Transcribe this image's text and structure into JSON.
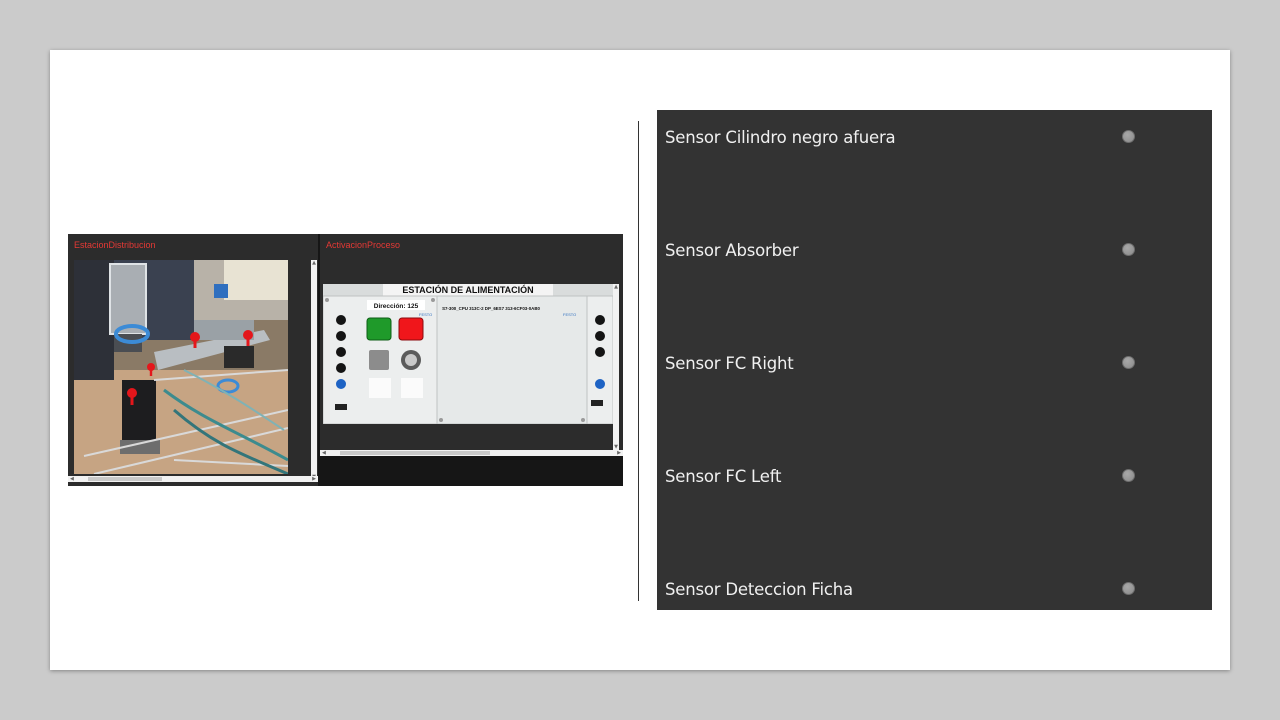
{
  "left_panels": {
    "station": {
      "title": "EstacionDistribucion"
    },
    "activation": {
      "title": "ActivacionProceso",
      "header_text": "ESTACIÓN DE ALIMENTACIÓN",
      "address_text": "Dirección: 125",
      "cpu_text": "S7-300_CPU 313C-2 DP_6ES7 313-6CF03-0AB0",
      "brand_text": "FESTO"
    }
  },
  "sensors": [
    {
      "label": "Sensor Cilindro negro afuera",
      "state": "off"
    },
    {
      "label": "Sensor Absorber",
      "state": "off"
    },
    {
      "label": "Sensor FC Right",
      "state": "off"
    },
    {
      "label": "Sensor FC Left",
      "state": "off"
    },
    {
      "label": "Sensor Deteccion Ficha",
      "state": "off"
    }
  ],
  "colors": {
    "page_background": "#cbcbcb",
    "slide_background": "#ffffff",
    "sensor_panel": "#333333",
    "panel_title": "#e53935",
    "led_off": "#8f8f8f"
  }
}
